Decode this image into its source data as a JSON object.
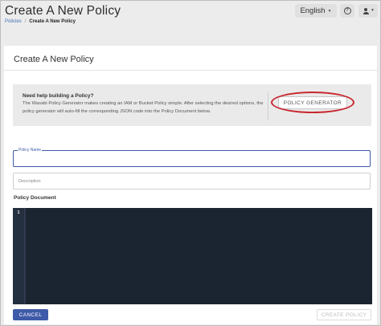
{
  "header": {
    "title": "Create A New Policy",
    "breadcrumb": {
      "parent": "Policies",
      "separator": "/",
      "current": "Create A New Policy"
    },
    "language": "English",
    "help_icon": "help-circle-icon",
    "user_icon": "user-icon"
  },
  "card": {
    "title": "Create A New Policy",
    "info": {
      "heading": "Need help building a Policy?",
      "text": "The Wasabi Policy Generator makes creating an IAM or Bucket Policy simple. After selecting the desired options, the policy generator will auto-fill the corresponding JSON code into the Policy Document below.",
      "button_label": "POLICY GENERATOR"
    },
    "policy_name": {
      "label": "Policy Name",
      "value": ""
    },
    "description": {
      "label": "Description",
      "value": ""
    },
    "document": {
      "label": "Policy Document",
      "line_number": "1"
    },
    "cancel_label": "CANCEL",
    "create_label": "CREATE POLICY"
  },
  "colors": {
    "accent": "#3f5aa8",
    "highlight_ring": "#c8262c",
    "editor_bg": "#1b2431"
  }
}
